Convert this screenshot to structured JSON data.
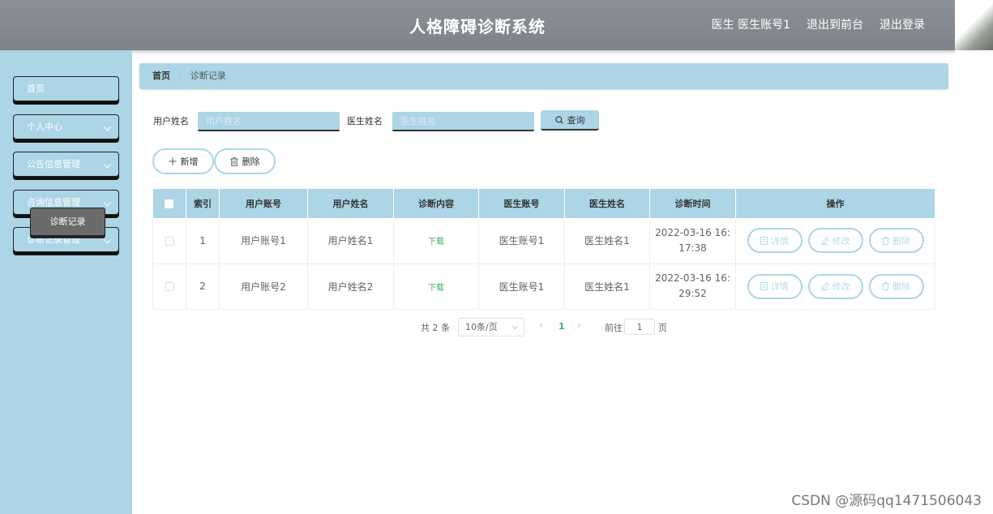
{
  "header": {
    "title": "人格障碍诊断系统",
    "user_label": "医生 医生账号1",
    "to_front": "退出到前台",
    "logout": "退出登录"
  },
  "sidebar": {
    "items": [
      {
        "label": "首页",
        "has_children": false
      },
      {
        "label": "个人中心",
        "has_children": true
      },
      {
        "label": "公告信息管理",
        "has_children": true
      },
      {
        "label": "咨询信息管理",
        "has_children": true
      },
      {
        "label": "诊断记录管理",
        "has_children": true
      }
    ],
    "active_sub": "诊断记录"
  },
  "breadcrumb": {
    "home": "首页",
    "separator": "/",
    "current": "诊断记录"
  },
  "search": {
    "user_label": "用户姓名",
    "user_placeholder": "用户姓名",
    "doctor_label": "医生姓名",
    "doctor_placeholder": "医生姓名",
    "query_label": "查询"
  },
  "actions": {
    "add": "新增",
    "delete": "删除"
  },
  "table": {
    "headers": [
      "索引",
      "用户账号",
      "用户姓名",
      "诊断内容",
      "医生账号",
      "医生姓名",
      "诊断时间",
      "操作"
    ],
    "rows": [
      {
        "index": "1",
        "user_account": "用户账号1",
        "user_name": "用户姓名1",
        "content": "下载",
        "doctor_account": "医生账号1",
        "doctor_name": "医生姓名1",
        "time_a": "2022-03-16 16:",
        "time_b": "17:38"
      },
      {
        "index": "2",
        "user_account": "用户账号2",
        "user_name": "用户姓名2",
        "content": "下载",
        "doctor_account": "医生账号1",
        "doctor_name": "医生姓名1",
        "time_a": "2022-03-16 16:",
        "time_b": "29:52"
      }
    ],
    "ops": {
      "detail": "详情",
      "edit": "修改",
      "delete": "删除"
    }
  },
  "pagination": {
    "total": "共 2 条",
    "page_size": "10条/页",
    "current_page": "1",
    "goto_label": "前往",
    "goto_value": "1",
    "goto_unit": "页"
  },
  "watermark": "CSDN @源码qq1471506043",
  "colors": {
    "accent": "#acd5e6",
    "header": "#858b90",
    "green": "#3cae67",
    "submenu": "#6b6b6b"
  }
}
